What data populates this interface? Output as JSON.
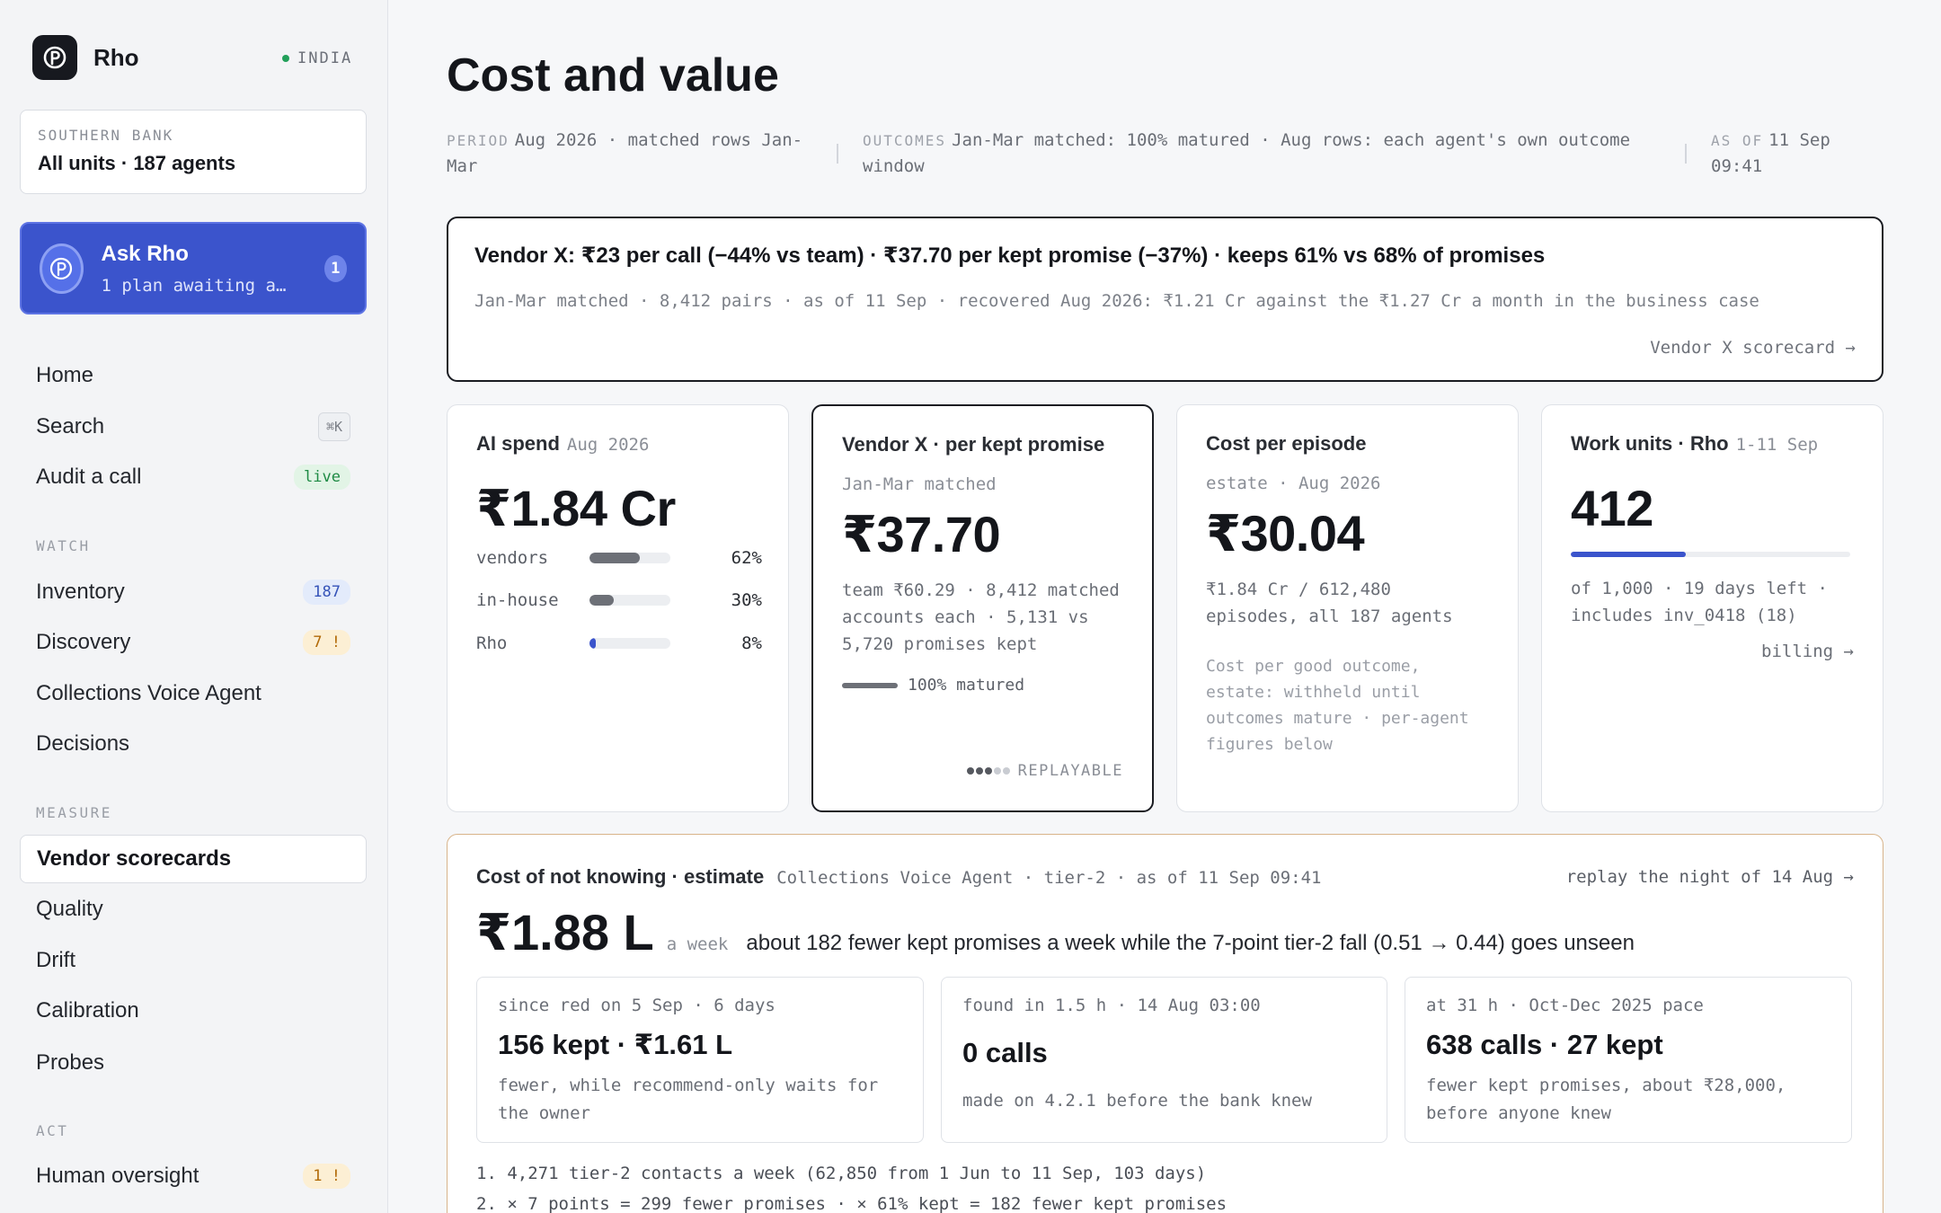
{
  "brand": {
    "name": "Rho",
    "logo_letter": "P",
    "region": "INDIA",
    "region_status_color": "#22a05a"
  },
  "org": {
    "name": "SOUTHERN BANK",
    "scope": "All units · 187 agents"
  },
  "ask": {
    "title": "Ask Rho",
    "subtitle": "1 plan awaiting a…",
    "badge": "1",
    "avatar_letter": "P"
  },
  "nav": {
    "home": "Home",
    "search": "Search",
    "search_shortcut": "⌘K",
    "audit": "Audit a call",
    "audit_badge": "live",
    "watch_label": "WATCH",
    "inventory": "Inventory",
    "inventory_badge": "187",
    "discovery": "Discovery",
    "discovery_badge": "7 !",
    "cva": "Collections Voice Agent",
    "decisions": "Decisions",
    "measure_label": "MEASURE",
    "vendor_scorecards": "Vendor scorecards",
    "quality": "Quality",
    "drift": "Drift",
    "calibration": "Calibration",
    "probes": "Probes",
    "act_label": "ACT",
    "human_oversight": "Human oversight",
    "human_oversight_badge": "1 !"
  },
  "page": {
    "title": "Cost and value",
    "period_key": "PERIOD",
    "period_value": "Aug 2026 · matched rows Jan-Mar",
    "outcomes_key": "OUTCOMES",
    "outcomes_value": "Jan-Mar matched: 100% matured · Aug rows: each agent's own outcome window",
    "asof_key": "AS OF",
    "asof_value": "11 Sep 09:41"
  },
  "headline": {
    "title": "Vendor X: ₹23 per call (−44% vs team) · ₹37.70 per kept promise (−37%) · keeps 61% vs 68% of promises",
    "subtitle": "Jan-Mar matched · 8,412 pairs · as of 11 Sep · recovered Aug 2026: ₹1.21 Cr against the ₹1.27 Cr a month in the business case",
    "link": "Vendor X scorecard →"
  },
  "ai_spend": {
    "title": "AI spend",
    "period": "Aug 2026",
    "value": "₹1.84 Cr",
    "breakdown": [
      {
        "label": "vendors",
        "pct": "62%",
        "share": 0.62,
        "color": "#6d7077"
      },
      {
        "label": "in-house",
        "pct": "30%",
        "share": 0.3,
        "color": "#6d7077"
      },
      {
        "label": "Rho",
        "pct": "8%",
        "share": 0.08,
        "color": "#3b54cc"
      }
    ]
  },
  "per_promise": {
    "title": "Vendor X · per kept promise",
    "sub": "Jan-Mar matched",
    "value": "₹37.70",
    "body": "team ₹60.29 · 8,412 matched accounts each · 5,131 vs 5,720 promises kept",
    "matured": "100% matured",
    "replay": "REPLAYABLE"
  },
  "episode": {
    "title": "Cost per episode",
    "sub": "estate · Aug 2026",
    "value": "₹30.04",
    "body": "₹1.84 Cr / 612,480 episodes, all 187 agents",
    "note": "Cost per good outcome, estate: withheld until outcomes mature · per-agent figures below"
  },
  "work_units": {
    "title": "Work units · Rho",
    "period": "1-11 Sep",
    "value": "412",
    "used_fraction": 0.412,
    "body": "of 1,000 · 19 days left · includes inv_0418 (18)",
    "link": "billing →"
  },
  "estimate": {
    "title": "Cost of not knowing · estimate",
    "context": "Collections Voice Agent · tier-2 · as of 11 Sep 09:41",
    "link": "replay the night of 14 Aug →",
    "value": "₹1.88 L",
    "unit": "a week",
    "desc": "about 182 fewer kept promises a week while the 7-point tier-2 fall (0.51 → 0.44) goes unseen",
    "cards": [
      {
        "meta": "since red on 5 Sep · 6 days",
        "value": "156 kept · ₹1.61 L",
        "note": "fewer, while recommend-only waits for the owner"
      },
      {
        "meta": "found in 1.5 h · 14 Aug 03:00",
        "value": "0 calls",
        "note": "made on 4.2.1 before the bank knew"
      },
      {
        "meta": "at 31 h · Oct-Dec 2025 pace",
        "value": "638 calls · 27 kept",
        "note": "fewer kept promises, about ₹28,000, before anyone knew"
      }
    ],
    "steps": [
      "1. 4,271 tier-2 contacts a week (62,850 from 1 Jun to 11 Sep, 103 days)",
      "2. × 7 points = 299 fewer promises · × 61% kept = 182 fewer kept promises"
    ]
  },
  "colors": {
    "accent": "#3b54cc",
    "estimate_border": "#d8b48a"
  }
}
